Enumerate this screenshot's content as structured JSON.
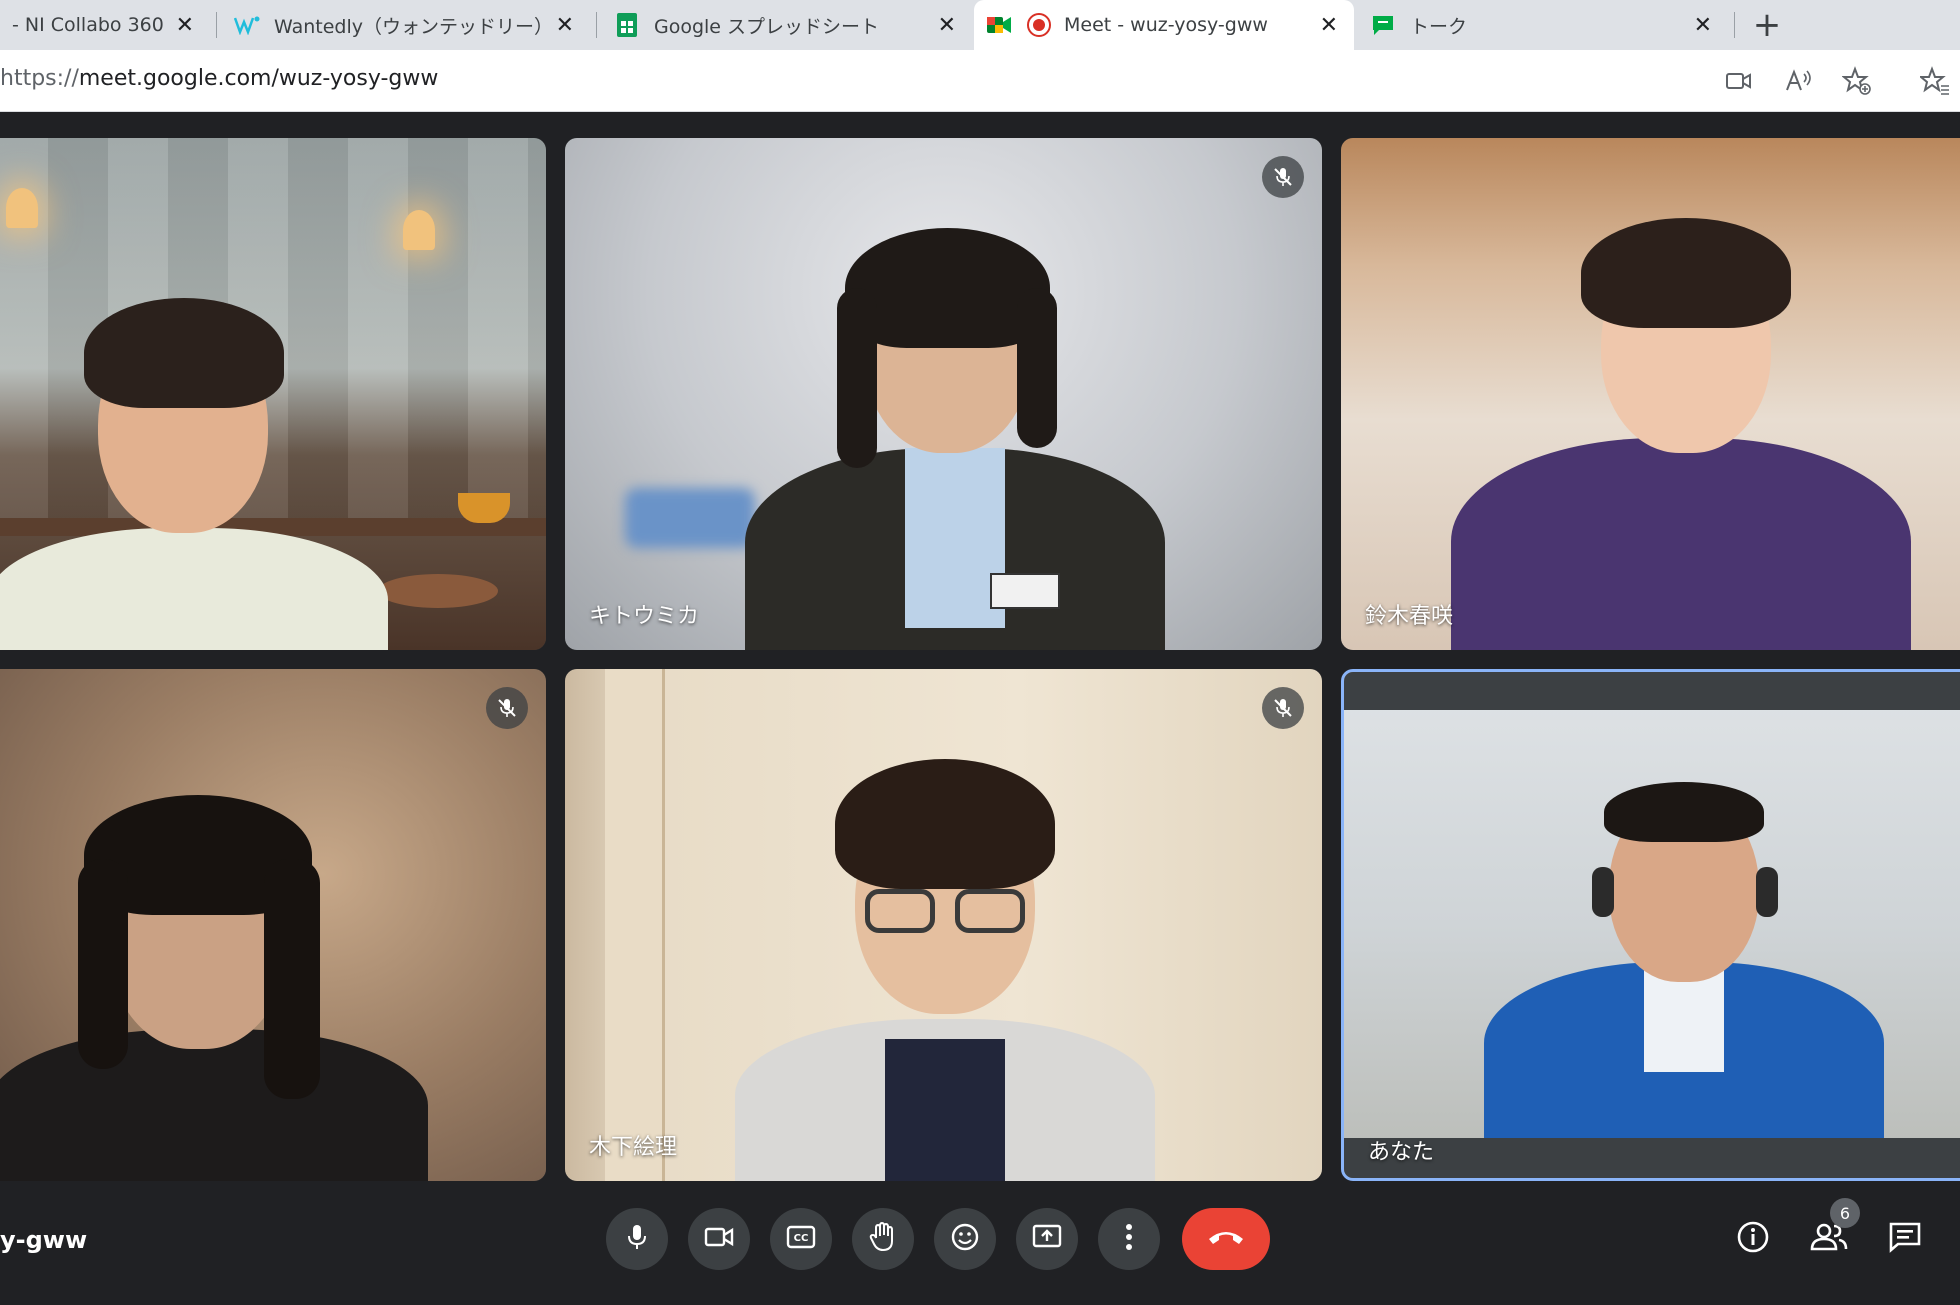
{
  "browser": {
    "tabs": [
      {
        "title": "- NI Collabo 360",
        "active": false
      },
      {
        "title": "Wantedly（ウォンテッドリー）はたら",
        "active": false
      },
      {
        "title": "Google スプレッドシート",
        "active": false
      },
      {
        "title": "Meet - wuz-yosy-gww",
        "active": true
      },
      {
        "title": "トーク",
        "active": false
      }
    ],
    "close_glyph": "✕",
    "new_tab_glyph": "+",
    "url_prefix": "https://",
    "url_main": "meet.google.com/wuz-yosy-gww"
  },
  "meet": {
    "meeting_code": "y-gww",
    "participants": [
      {
        "name": "",
        "muted": false
      },
      {
        "name": "キトウミカ",
        "muted": true
      },
      {
        "name": "鈴木春咲",
        "muted": false
      },
      {
        "name": "",
        "muted": true
      },
      {
        "name": "木下絵理",
        "muted": true
      },
      {
        "name": "あなた",
        "muted": false,
        "self": true
      }
    ],
    "people_count": "6"
  },
  "colors": {
    "background": "#202124",
    "control": "#3c4043",
    "end_call": "#ea4335",
    "self_border": "#8ab4f8"
  },
  "icons": [
    "microphone-icon",
    "camera-icon",
    "captions-icon",
    "raise-hand-icon",
    "emoji-icon",
    "present-icon",
    "more-options-icon",
    "end-call-icon",
    "info-icon",
    "people-icon",
    "chat-icon",
    "mic-off-icon"
  ]
}
